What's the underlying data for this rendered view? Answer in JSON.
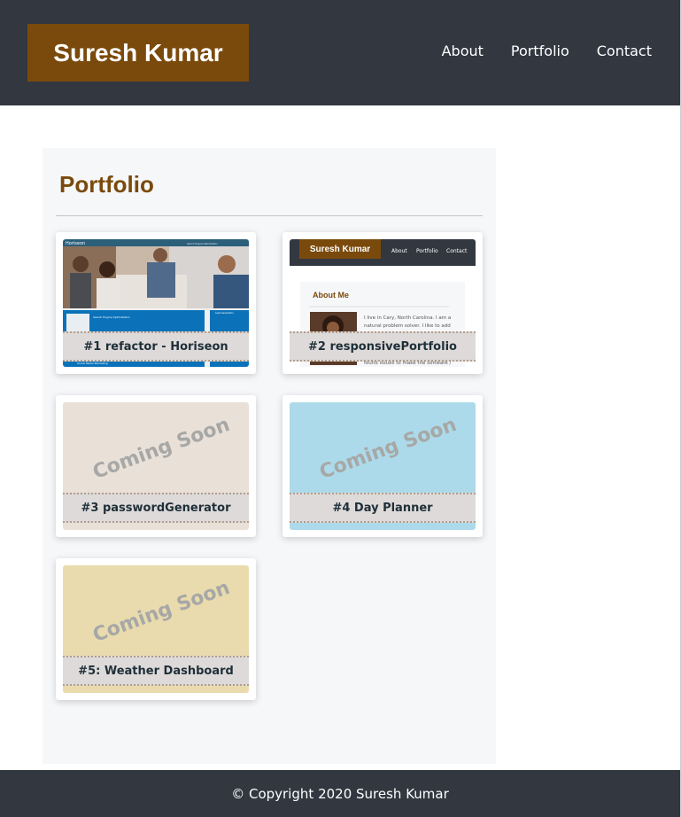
{
  "header": {
    "brand": "Suresh Kumar",
    "nav": [
      {
        "label": "About"
      },
      {
        "label": "Portfolio"
      },
      {
        "label": "Contact"
      }
    ]
  },
  "portfolio": {
    "title": "Portfolio",
    "projects": [
      {
        "caption": "#1 refactor - Horiseon",
        "screenshot": {
          "logo": "Horiseon",
          "nav": [
            "Search Engine Optimization",
            "Online Reputation Management",
            "Social Media Marketing"
          ],
          "section_1": "Search Engine Optimization",
          "sidebar": "Lead Generation",
          "section_2": "Social Media Marketing"
        }
      },
      {
        "caption": "#2 responsivePortfolio",
        "screenshot": {
          "brand": "Suresh Kumar",
          "nav": [
            "About",
            "Portfolio",
            "Contact"
          ],
          "heading": "About Me",
          "bio_lines": [
            "I live in Cary, North Carolina. I am a",
            "natural problem solver. I like to add",
            "found issues to make the software /"
          ]
        }
      },
      {
        "caption": "#3 passwordGenerator",
        "overlay": "Coming Soon",
        "color": "#e9e0d8"
      },
      {
        "caption": "#4 Day Planner",
        "overlay": "Coming Soon",
        "color": "#acdaea"
      },
      {
        "caption": "#5: Weather Dashboard",
        "overlay": "Coming Soon",
        "color": "#e9dbae"
      }
    ]
  },
  "footer": {
    "copyright": "© Copyright 2020 Suresh Kumar"
  }
}
